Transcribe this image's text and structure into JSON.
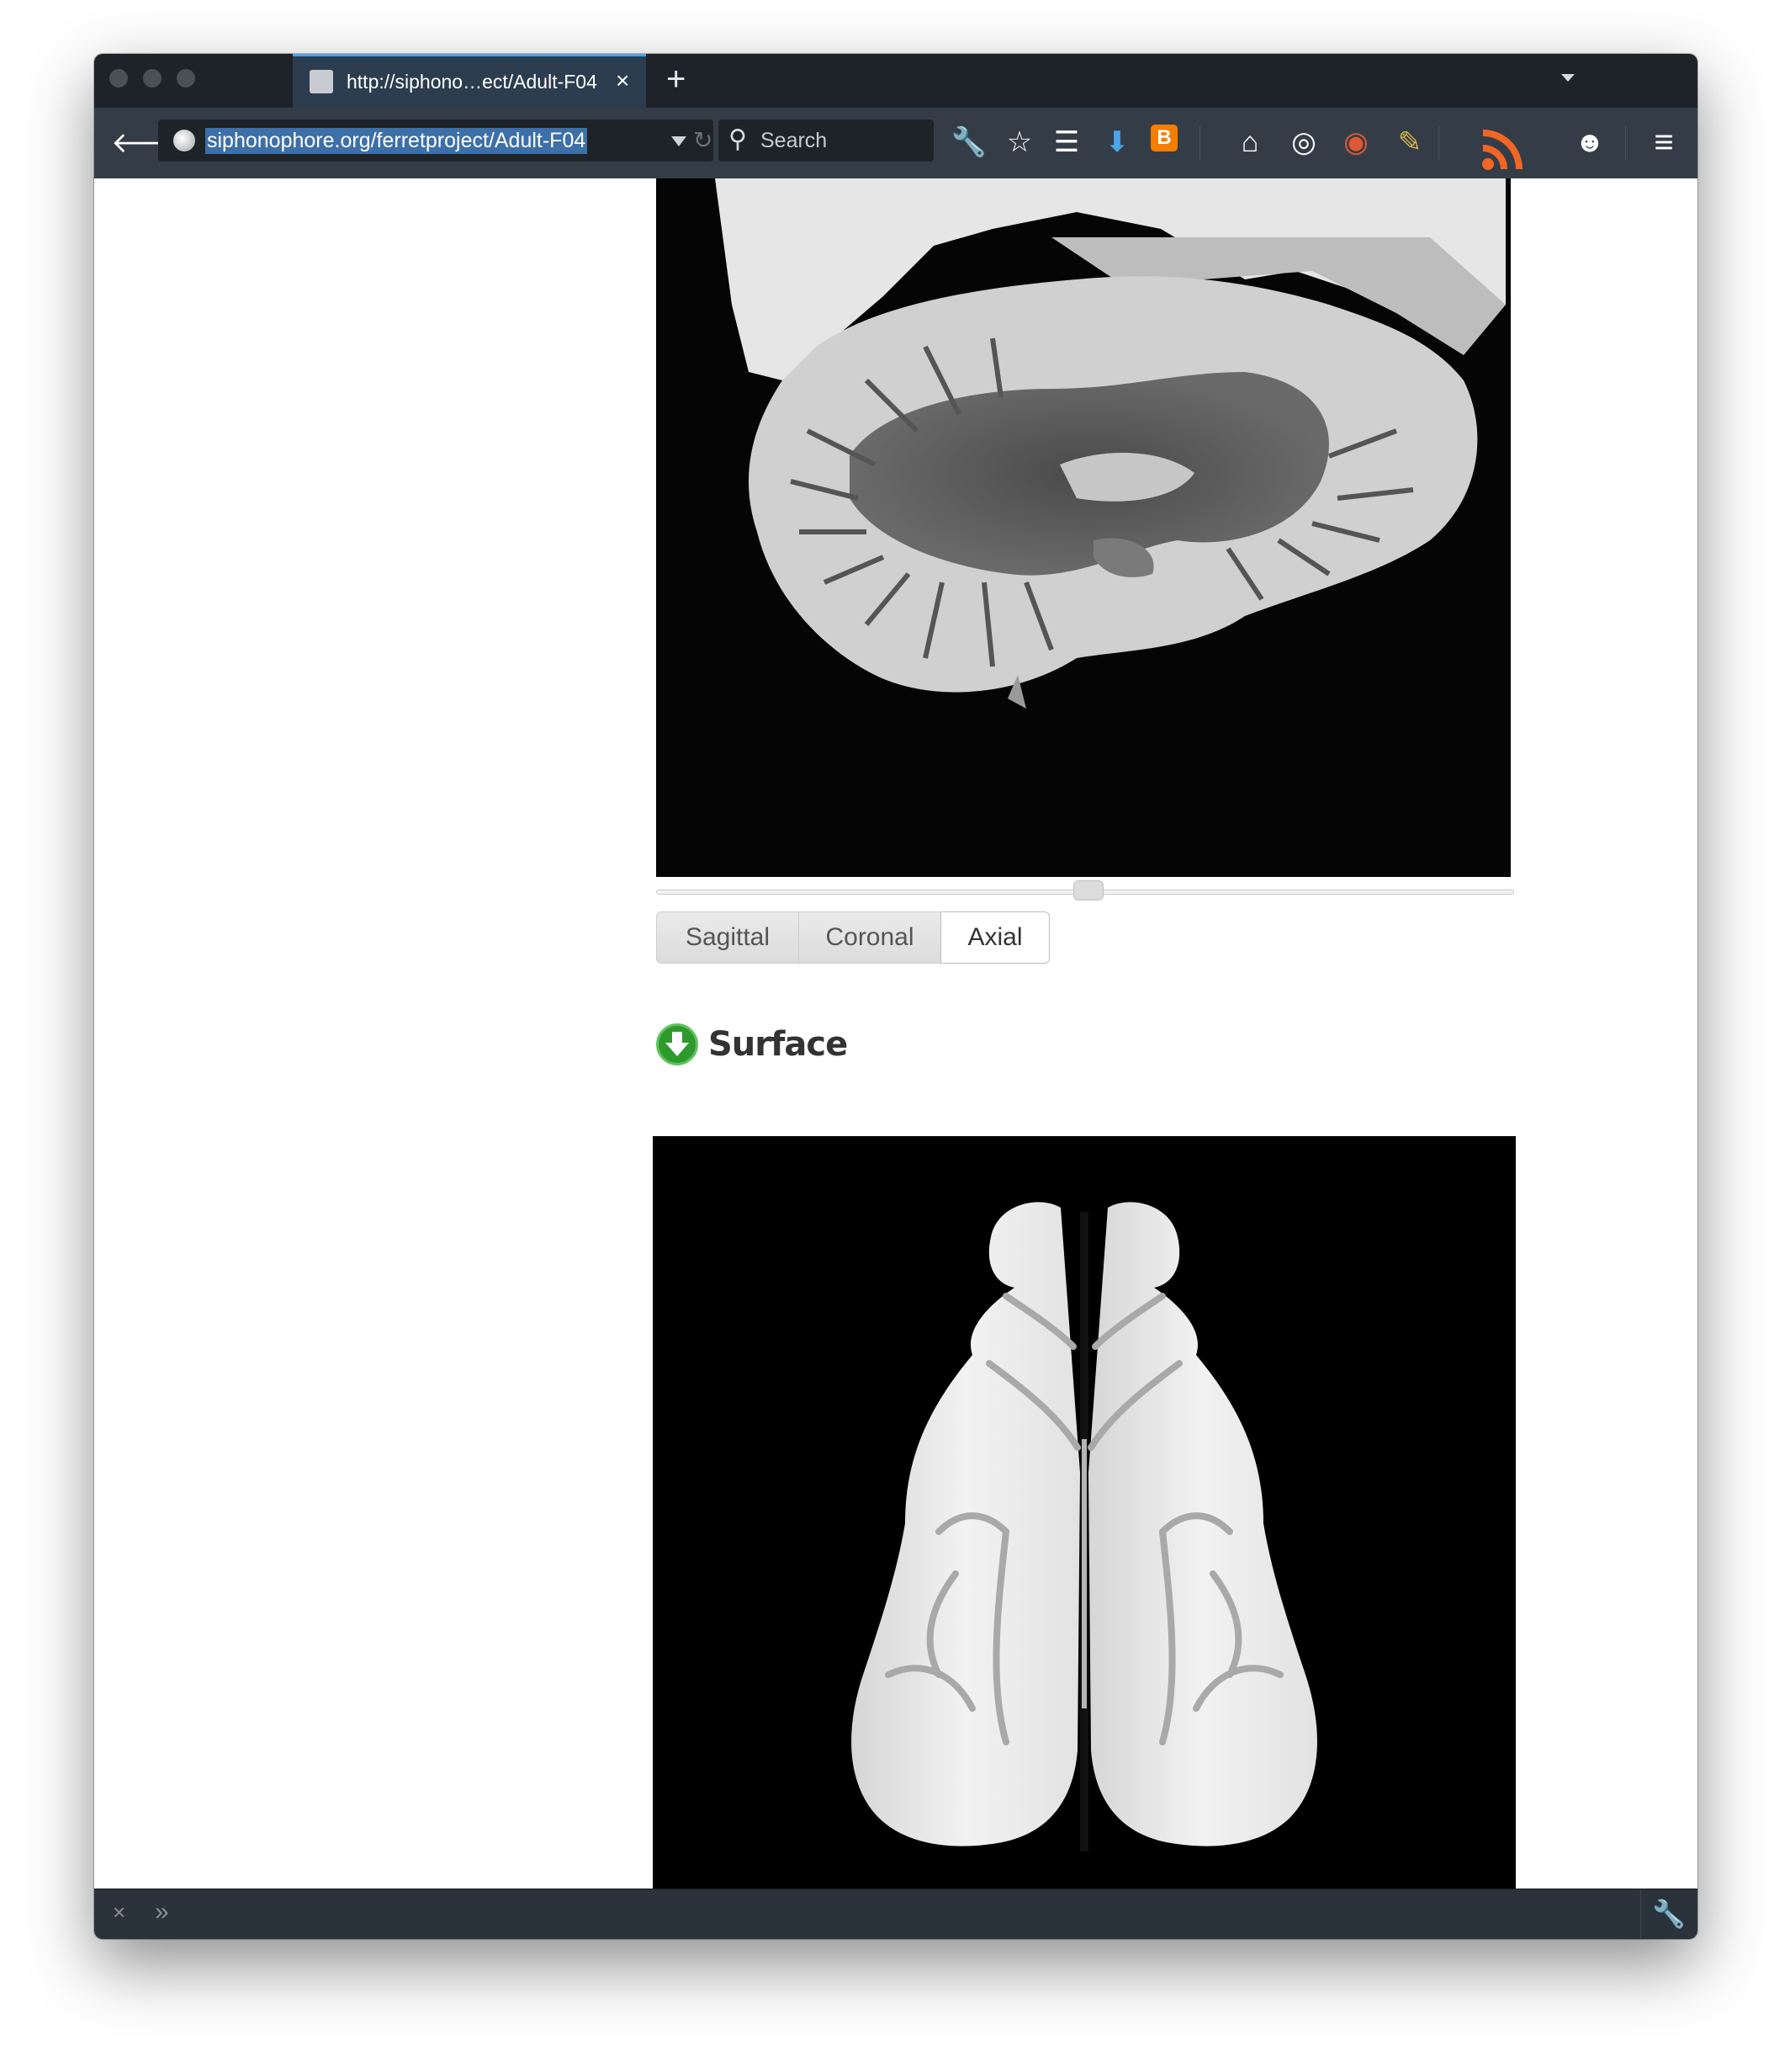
{
  "tab": {
    "title": "http://siphono…ect/Adult-F04",
    "close": "×",
    "new_tab": "+"
  },
  "navbar": {
    "back": "🡐",
    "url": "siphonophore.org/ferretproject/Adult-F04",
    "reload": "↻",
    "search_placeholder": "Search",
    "search_glyph": "⚲",
    "icons": {
      "wrench": "🔧",
      "bookmark_star": "☆",
      "reading_list": "☰",
      "download": "⬇",
      "blogger": "B",
      "home": "⌂",
      "privacy_badger": "◎",
      "duckduckgo": "◉",
      "pencil": "✎",
      "rss": "◠",
      "chat": "☻",
      "menu": "≡"
    }
  },
  "viewer": {
    "view_buttons": [
      "Sagittal",
      "Coronal",
      "Axial"
    ],
    "selected_view": "Axial",
    "slider_position": 0.5
  },
  "surface": {
    "title": "Surface",
    "download_glyph": "⬇"
  },
  "statusbar": {
    "close": "×",
    "expand": "»",
    "wrench": "🔧"
  },
  "colors": {
    "chrome_dark": "#1d2329",
    "toolbar": "#343d47",
    "tab_active": "#2b3d4f",
    "url_highlight": "#3d6fa8",
    "download_green": "#2e9a2e"
  }
}
